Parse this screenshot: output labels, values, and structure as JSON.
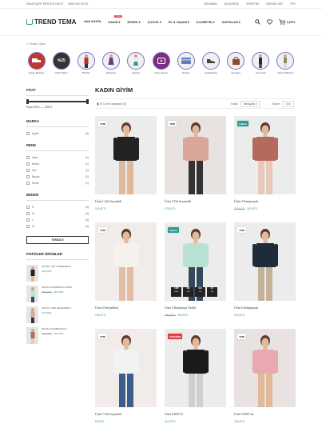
{
  "topbar": {
    "shipping": "WHATSAPP DESTEK HATTI",
    "phone": "0505 000 00 00",
    "links": [
      "HESABIM",
      "ALIŞVERİŞ",
      "SEPETİM",
      "ÖDEME YAP",
      "TRY"
    ]
  },
  "header": {
    "logo": "TREND TEMA",
    "nav": [
      {
        "label": "ANA SAYFA",
        "badge": ""
      },
      {
        "label": "KADIN",
        "badge": "Trend"
      },
      {
        "label": "ERKEK",
        "badge": ""
      },
      {
        "label": "ÇOCUK",
        "badge": ""
      },
      {
        "label": "EV & YAŞAM",
        "badge": ""
      },
      {
        "label": "KOZMETİK",
        "badge": ""
      },
      {
        "label": "SAYFALAR",
        "badge": ""
      }
    ],
    "cart_total": "0,00TL"
  },
  "breadcrumb": "Kadın Giyim",
  "categories": [
    "Kargo Bedava",
    "%25 İndirim",
    "Bluzlar",
    "Elbiseler",
    "Etekler",
    "Video Demo",
    "Hediye",
    "Ayakkabılar",
    "Çantalar",
    "Kozmetik",
    "Tekrar Bildirimi"
  ],
  "sidebar": {
    "price_title": "FİYAT",
    "price_range": "Fiyat: 80TL — 300TL",
    "brand_title": "MARKA",
    "brands": [
      {
        "name": "Apple",
        "count": "(6)"
      }
    ],
    "color_title": "RENK",
    "colors": [
      {
        "name": "Mavi",
        "count": "(1)"
      },
      {
        "name": "Bordo",
        "count": "(1)"
      },
      {
        "name": "Sarı",
        "count": "(1)"
      },
      {
        "name": "Beyaz",
        "count": "(1)"
      },
      {
        "name": "Siyah",
        "count": "(1)"
      }
    ],
    "size_title": "BEDEN",
    "sizes": [
      {
        "name": "S",
        "count": "(4)"
      },
      {
        "name": "M",
        "count": "(4)"
      },
      {
        "name": "L",
        "count": "(4)"
      },
      {
        "name": "XL",
        "count": "(4)"
      }
    ],
    "filter_button": "TEMİZLE",
    "popular_title": "POPÜLER ÜRÜNLER",
    "popular": [
      {
        "name": "ÜRÜN 1 ŞİFT SEÇENEKLİ",
        "old": "",
        "price": "100,00TL"
      },
      {
        "name": "ÜRÜN 5 KAMPANYA Tarihli",
        "old": "280,00TL",
        "price": "250,00TL"
      },
      {
        "name": "ÜRÜN 2 TEK SEÇENEKLİ",
        "old": "",
        "price": "170,00TL"
      },
      {
        "name": "ÜRÜN 4 KAMPANYALI",
        "old": "180,00TL",
        "price": "150,00TL"
      }
    ]
  },
  "main": {
    "title": "KADIN GİYİM",
    "result_count": "Ürün Karşılaştır (0)",
    "sort_label": "Sırala",
    "sort_value": "Varsayılan",
    "show_label": "Göster:",
    "show_value": "15",
    "products": [
      {
        "tag": "YENİ",
        "tag_type": "new",
        "name": "Ürün 1 Çift Seçenekli",
        "old": "",
        "price": "100,00TL",
        "countdown": false,
        "bg": "",
        "dress": "#222222",
        "legs": "#e0b89a"
      },
      {
        "tag": "YENİ",
        "tag_type": "new",
        "name": "Ürün 2 Tek Seçenekli",
        "old": "",
        "price": "170,00TL",
        "countdown": false,
        "bg": "bg2",
        "dress": "#d9a69a",
        "legs": "#333333"
      },
      {
        "tag": "İndirim",
        "tag_type": "sale",
        "name": "Ürün 4 Kampanyalı",
        "old": "180,00TL",
        "price": "150,00TL",
        "countdown": false,
        "bg": "",
        "dress": "#b56a5e",
        "legs": "#e8c8b8"
      },
      {
        "tag": "YENİ",
        "tag_type": "new",
        "name": "Ürün 4 Seçenekleri",
        "old": "",
        "price": "230,00TL",
        "countdown": false,
        "bg": "bg3",
        "dress": "#f5f2ee",
        "legs": "#e2bfa4"
      },
      {
        "tag": "İndirim",
        "tag_type": "sale",
        "name": "Ürün 5 Kampanya Tarihli",
        "old": "280,00TL",
        "price": "250,00TL",
        "countdown": true,
        "bg": "",
        "dress": "#b9e1d3",
        "legs": "#34495e"
      },
      {
        "tag": "YENİ",
        "tag_type": "new",
        "name": "Ürün 6 Kampanyalı",
        "old": "",
        "price": "210,00TL",
        "countdown": false,
        "bg": "",
        "dress": "#1d2b3a",
        "legs": "#c4b39a"
      },
      {
        "tag": "YENİ",
        "tag_type": "new",
        "name": "Ürün 7 Tek Seçenekli",
        "old": "",
        "price": "80,00TL",
        "countdown": false,
        "bg": "bg3",
        "dress": "#f2f2f2",
        "legs": "#3b5f8a"
      },
      {
        "tag": "%İNDİRİM",
        "tag_type": "hot",
        "name": "Ürün 8 KDV'li",
        "old": "",
        "price": "210,00TL",
        "countdown": false,
        "bg": "",
        "dress": "#1a1a1a",
        "legs": "#cfcfcf"
      },
      {
        "tag": "YENİ",
        "tag_type": "new",
        "name": "Ürün 9 KDV'siz",
        "old": "",
        "price": "185,00TL",
        "countdown": false,
        "bg": "bg2",
        "dress": "#e8a9b0",
        "legs": "#e0b89a"
      }
    ],
    "countdown": [
      {
        "v": "759",
        "l": "GÜN"
      },
      {
        "v": "04",
        "l": "SA"
      },
      {
        "v": "04",
        "l": "DK"
      },
      {
        "v": "57",
        "l": "SN"
      }
    ]
  }
}
